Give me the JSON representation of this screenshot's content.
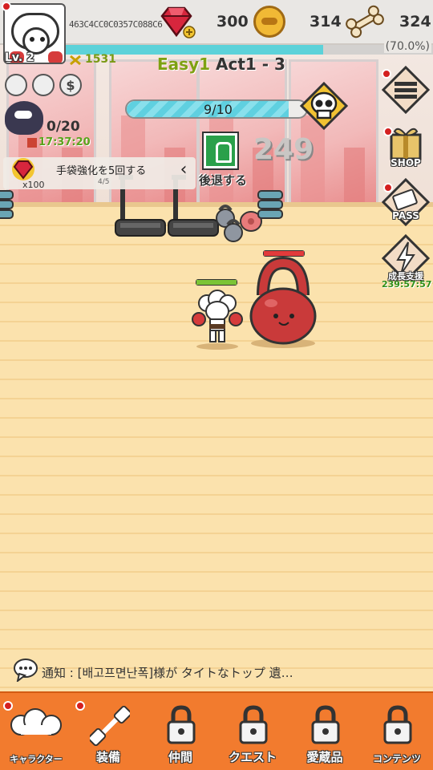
{
  "player": {
    "uid": "463C4CC0C0357C088C6",
    "level": "Lv. 2",
    "power": "1531"
  },
  "resources": {
    "gems": "300",
    "coins": "314",
    "bones": "324"
  },
  "exp": {
    "percent_label": "(70.0%)",
    "fraction": 0.7
  },
  "stage": {
    "difficulty": "Easy1",
    "act": "Act1 - 3"
  },
  "wave": {
    "label": "9/10",
    "fraction": 0.9
  },
  "crow": {
    "count": "0/20",
    "timer": "17:37:20"
  },
  "quest": {
    "reward": "x100",
    "text": "手袋強化を5回する",
    "progress": "4/5"
  },
  "retreat": {
    "label": "後退する"
  },
  "damage": "249",
  "side_menu": {
    "shop": "SHOP",
    "pass": "PASS",
    "growth": "成長支援",
    "growth_timer": "239:57:57"
  },
  "notice": {
    "prefix": "通知 :",
    "message": "[배고프면난폭]様が タイトなトップ 遺…"
  },
  "nav": {
    "tabs": [
      "キャラクター",
      "装備",
      "仲間",
      "クエスト",
      "愛蔵品",
      "コンテンツ"
    ]
  },
  "colors": {
    "accent_orange": "#f27b2e",
    "exp_cyan": "#5cd2d9",
    "hp_green": "#7bc436",
    "hp_red": "#e23b3b",
    "stage_green": "#7ea112"
  },
  "icons": [
    "gem-icon",
    "coin-icon",
    "bone-icon",
    "skull-icon",
    "menu-icon",
    "shop-gift-icon",
    "pass-ticket-icon",
    "lightning-icon",
    "chat-bubble-icon",
    "lock-icon",
    "dumbbell-icon"
  ]
}
